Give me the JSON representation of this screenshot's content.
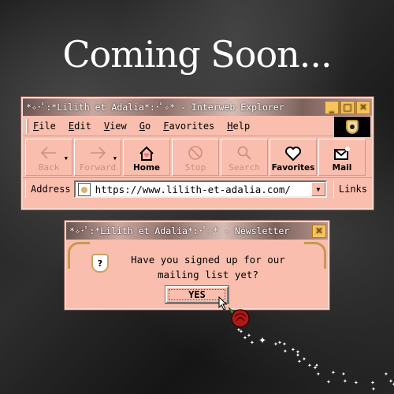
{
  "headline": "Coming Soon...",
  "browser": {
    "title": "*✧･ﾟ:*Lilith et Adalia*:･ﾟ✧* - Interweb Explorer",
    "window_buttons": [
      "minimize",
      "maximize",
      "close"
    ],
    "menu": [
      {
        "accel": "F",
        "rest": "ile"
      },
      {
        "accel": "E",
        "rest": "dit"
      },
      {
        "accel": "V",
        "rest": "iew"
      },
      {
        "accel": "G",
        "rest": "o"
      },
      {
        "accel": "F",
        "rest": "avorites"
      },
      {
        "accel": "H",
        "rest": "elp"
      }
    ],
    "toolbar": {
      "back": "Back",
      "forward": "Forward",
      "home": "Home",
      "stop": "Stop",
      "search": "Search",
      "favorites": "Favorites",
      "mail": "Mail"
    },
    "address_label": "Address",
    "url": "https://www.lilith-et-adalia.com/",
    "links_label": "Links"
  },
  "dialog": {
    "title": "*✧･ﾟ:*Lilith et Adalia*:･ﾟ✧* - Newsletter",
    "message_line1": "Have you signed up for our",
    "message_line2": "mailing list yet?",
    "icon_glyph": "?",
    "yes_label": "YES"
  },
  "colors": {
    "window_bg": "#f9beae",
    "title_button": "#f6c45a",
    "rose": "#b01818"
  }
}
